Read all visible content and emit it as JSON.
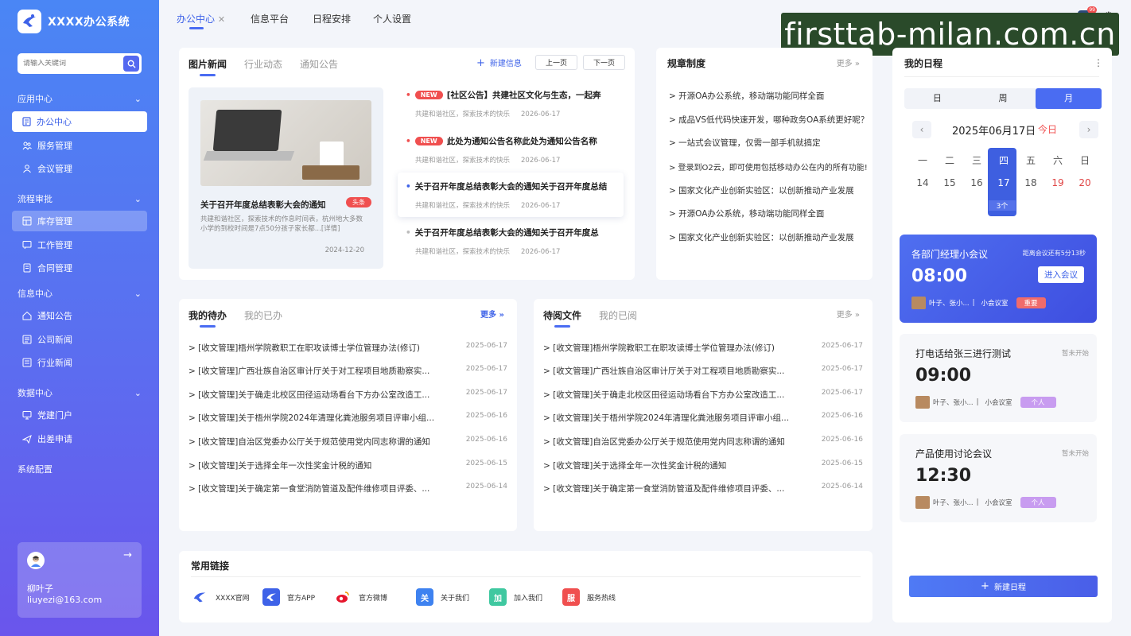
{
  "app": {
    "title": "XXXX办公系统",
    "search_placeholder": "请输入关键词"
  },
  "sidebar": {
    "sections": [
      {
        "label": "应用中心",
        "items": [
          "办公中心",
          "服务管理",
          "会议管理"
        ]
      },
      {
        "label": "流程审批",
        "items": [
          "库存管理",
          "工作管理",
          "合同管理"
        ]
      },
      {
        "label": "信息中心",
        "items": [
          "通知公告",
          "公司新闻",
          "行业新闻"
        ]
      },
      {
        "label": "数据中心",
        "items": [
          "党建门户",
          "出差申请"
        ]
      }
    ],
    "config": "系统配置",
    "user": {
      "name": "柳叶子",
      "email": "liuyezi@163.com"
    }
  },
  "topnav": {
    "tabs": [
      "办公中心",
      "信息平台",
      "日程安排",
      "个人设置"
    ],
    "notification_count": "99"
  },
  "watermark": "firsttab-milan.com.cn",
  "news_card": {
    "tabs": [
      "图片新闻",
      "行业动态",
      "通知公告"
    ],
    "new_btn": "新建信息",
    "prev": "上一页",
    "next": "下一页",
    "featured": {
      "title": "关于召开年度总结表彰大会的通知",
      "tag": "头条",
      "desc": "共建和谐社区，探索技术的作息时间表，杭州地大多数小学的到校时间是7点50分孩子家长都...[详情]",
      "date": "2024-12-20"
    },
    "items": [
      {
        "badge": "NEW",
        "title": "[社区公告】共建社区文化与生态，一起奔",
        "sub": "共建和谐社区，探索技术的快乐",
        "date": "2026-06-17"
      },
      {
        "badge": "NEW",
        "title": "此处为通知公告名称此处为通知公告名称",
        "sub": "共建和谐社区，探索技术的快乐",
        "date": "2026-06-17"
      },
      {
        "badge": "",
        "title": "关于召开年度总结表彰大会的通知关于召开年度总结",
        "sub": "共建和谐社区，探索技术的快乐",
        "date": "2026-06-17"
      },
      {
        "badge": "",
        "title": "关于召开年度总结表彰大会的通知关于召开年度总",
        "sub": "共建和谐社区，探索技术的快乐",
        "date": "2026-06-17"
      }
    ]
  },
  "rules_card": {
    "title": "规章制度",
    "more": "更多",
    "items": [
      "> 开源OA办公系统，移动端功能同样全面",
      "> 成品VS低代码快速开发，哪种政务OA系统更好呢？",
      "> 一站式会议管理，仅需一部手机就搞定",
      "> 登录到O2云，即可使用包括移动办公在内的所有功能!",
      "> 国家文化产业创新实验区：以创新推动产业发展",
      "> 开源OA办公系统，移动端功能同样全面",
      "> 国家文化产业创新实验区：以创新推动产业发展"
    ]
  },
  "todo_card": {
    "tabs": [
      "我的待办",
      "我的已办"
    ],
    "more": "更多",
    "rows": [
      {
        "t": "> [收文管理]梧州学院教职工在职攻读博士学位管理办法(修订)",
        "d": "2025-06-17"
      },
      {
        "t": "> [收文管理]广西壮族自治区审计厅关于对工程项目地质勘察实...",
        "d": "2025-06-17"
      },
      {
        "t": "> [收文管理]关于确走北校区田径运动场看台下方办公室改造工...",
        "d": "2025-06-17"
      },
      {
        "t": "> [收文管理]关于梧州学院2024年清理化粪池服务项目评审小组...",
        "d": "2025-06-16"
      },
      {
        "t": "> [收文管理]自治区党委办公厅关于规范使用党内同志称谓的通知",
        "d": "2025-06-16"
      },
      {
        "t": "> [收文管理]关于选择全年一次性奖金计税的通知",
        "d": "2025-06-15"
      },
      {
        "t": "> [收文管理]关于确定第一食堂消防管道及配件维修项目评委、...",
        "d": "2025-06-14"
      }
    ]
  },
  "read_card": {
    "tabs": [
      "待阅文件",
      "我的已阅"
    ],
    "more": "更多",
    "rows": [
      {
        "t": "> [收文管理]梧州学院教职工在职攻读博士学位管理办法(修订)",
        "d": "2025-06-17"
      },
      {
        "t": "> [收文管理]广西壮族自治区审计厅关于对工程项目地质勘察实...",
        "d": "2025-06-17"
      },
      {
        "t": "> [收文管理]关于确走北校区田径运动场看台下方办公室改造工...",
        "d": "2025-06-17"
      },
      {
        "t": "> [收文管理]关于梧州学院2024年清理化粪池服务项目评审小组...",
        "d": "2025-06-16"
      },
      {
        "t": "> [收文管理]自治区党委办公厅关于规范使用党内同志称谓的通知",
        "d": "2025-06-16"
      },
      {
        "t": "> [收文管理]关于选择全年一次性奖金计税的通知",
        "d": "2025-06-15"
      },
      {
        "t": "> [收文管理]关于确定第一食堂消防管道及配件维修项目评委、...",
        "d": "2025-06-14"
      }
    ]
  },
  "links": {
    "title": "常用链接",
    "items": [
      "XXXX官网",
      "官方APP",
      "官方微博",
      "关于我们",
      "加入我们",
      "服务热线"
    ],
    "icons": [
      "关",
      "加",
      "服"
    ]
  },
  "schedule": {
    "title": "我的日程",
    "views": [
      "日",
      "周",
      "月"
    ],
    "date": "2025年06月17日",
    "today": "今日",
    "weekdays": [
      "一",
      "二",
      "三",
      "四",
      "五",
      "六",
      "日"
    ],
    "days": [
      "14",
      "15",
      "16",
      "17",
      "18",
      "19",
      "20"
    ],
    "count": "3个",
    "meetings": [
      {
        "title": "各部门经理小会议",
        "status": "距离会议还有5分13秒",
        "time": "08:00",
        "btn": "进入会议",
        "people": "叶子、张小...",
        "room": "小会议室",
        "tag": "重要"
      },
      {
        "title": "打电话给张三进行测试",
        "status": "暂未开始",
        "time": "09:00",
        "people": "叶子、张小...",
        "room": "小会议室",
        "tag": "个人"
      },
      {
        "title": "产品使用讨论会议",
        "status": "暂未开始",
        "time": "12:30",
        "people": "叶子、张小...",
        "room": "小会议室",
        "tag": "个人"
      }
    ],
    "new_btn": "新建日程"
  }
}
